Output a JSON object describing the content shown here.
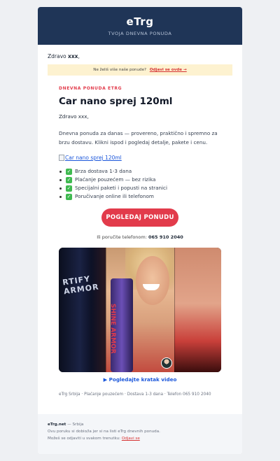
{
  "header": {
    "brand": "eTrg",
    "tagline": "TVOJA DNEVNA PONUDA"
  },
  "greeting": {
    "prefix": "Zdravo ",
    "name": "xxx",
    "suffix": ","
  },
  "unsubscribe_bar": {
    "text": "Ne želiš više naše ponude?",
    "link": "Odjavi se ovde →"
  },
  "offer": {
    "kicker": "DNEVNA PONUDA ETRG",
    "title": "Car nano sprej 120ml",
    "hello": "Zdravo xxx,",
    "description": "Dnevna ponuda za danas — provereno, praktično i spremno za brzu dostavu. Klikni ispod i pogledaj detalje, pakete i cenu.",
    "image_alt": "Car nano sprej 120ml",
    "features": [
      "Brza dostava 1-3 dana",
      "Plaćanje pouzećem — bez rizika",
      "Specijalni paketi i popusti na stranici",
      "Poručivanje online ili telefonom"
    ],
    "cta_label": "POGLEDAJ PONUDU",
    "phone_prefix": "Ili poručite telefonom:",
    "phone_number": "065 910 2040",
    "video_text_left": "RTIFY ARMOR",
    "bottle_label": "SHINE ARMOR",
    "video_link": "▶ Pogledajte kratak video",
    "meta": "eTrg Srbija · Plaćanje pouzećem · Dostava 1-3 dana · Telefon 065 910 2040"
  },
  "footer": {
    "site": "eTrg.net",
    "location": "— Srbija",
    "line1": "Ovu poruku si dobio/la jer si na listi eTrg dnevnih ponuda.",
    "line2": "Možeš se odjaviti u svakom trenutku:",
    "unsubscribe_link": "Odjavi se"
  },
  "colors": {
    "header_bg": "#1f3557",
    "accent": "#e23b4b",
    "link": "#1a56db",
    "notice_bg": "#fdf2d0"
  },
  "icons": [
    "broken-image-icon",
    "checkmark-icon",
    "play-icon",
    "avatar-icon"
  ]
}
